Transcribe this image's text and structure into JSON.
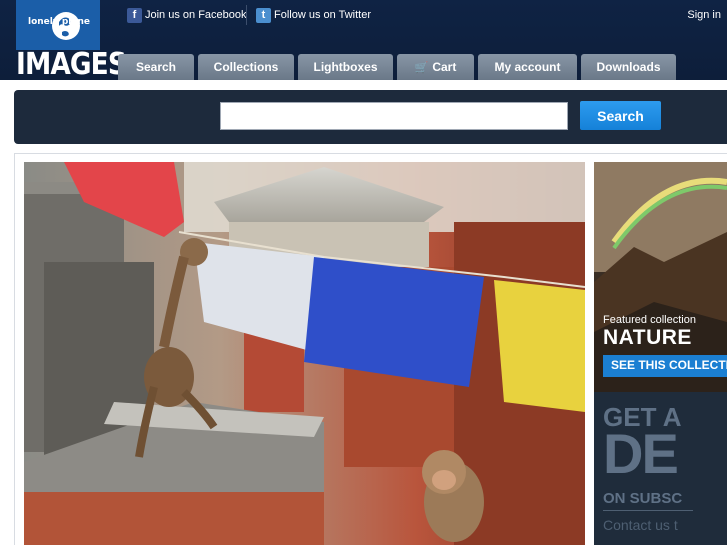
{
  "logo": {
    "brand_small": "lonely planet",
    "brand_big": "IMAGES"
  },
  "header": {
    "facebook_label": "Join us on Facebook",
    "twitter_label": "Follow us on Twitter",
    "signin_label": "Sign in"
  },
  "tabs": [
    {
      "label": "Search"
    },
    {
      "label": "Collections"
    },
    {
      "label": "Lightboxes"
    },
    {
      "label": "Cart"
    },
    {
      "label": "My account"
    },
    {
      "label": "Downloads"
    }
  ],
  "search": {
    "value": "",
    "button_label": "Search"
  },
  "side": {
    "featured_label": "Featured collection",
    "featured_title": "NATURE",
    "see_button": "SEE THIS COLLECTION",
    "promo_line1": "GET A",
    "promo_line2": "DE",
    "promo_line3": "ON SUBSC",
    "promo_line4": "Contact us t"
  },
  "colors": {
    "header_bg": "#0f2344",
    "logo_blue": "#1b5ea8",
    "tab_gray": "#7a8898",
    "search_band": "#1d2a3c",
    "accent_blue": "#1581d8"
  }
}
